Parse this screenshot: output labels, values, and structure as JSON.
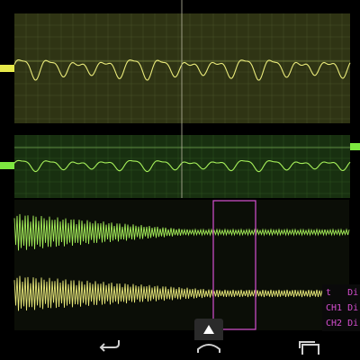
{
  "colors": {
    "background": "#000000",
    "ch1_trace": "#e9ea7a",
    "ch2_trace": "#a6f05a",
    "ch1_panel": "#2f3414",
    "ch2_panel": "#183010",
    "grid": "#5c6b3a",
    "marker_ch1": "#e6e94a",
    "marker_ch2": "#7ee840",
    "zoom_window": "#d64fd0",
    "info_text": "#d64fd0"
  },
  "info_panel": {
    "rows": [
      {
        "label": "t",
        "value": "Di"
      },
      {
        "label": "CH1",
        "value": "Di"
      },
      {
        "label": "CH2",
        "value": "Di"
      }
    ]
  },
  "icons": {
    "pull_tab": "chevron-up-icon",
    "back": "back-icon",
    "home": "home-icon",
    "recents": "recents-icon"
  }
}
